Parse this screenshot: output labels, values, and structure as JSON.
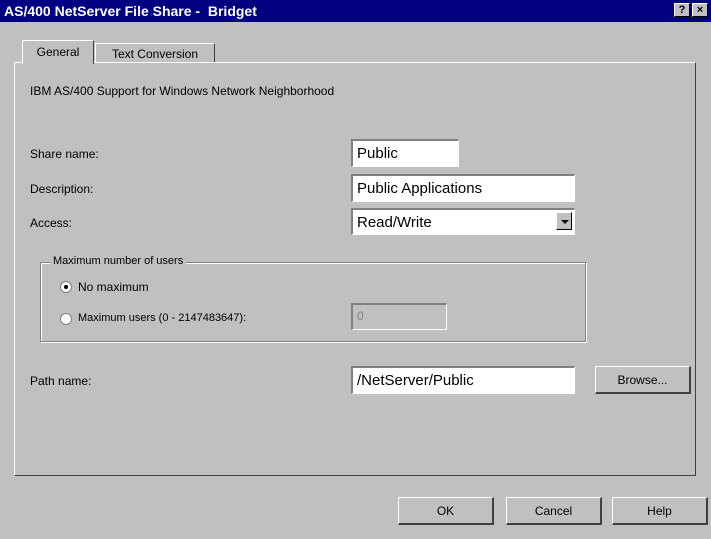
{
  "window": {
    "title": "AS/400 NetServer File Share -  Bridget",
    "help_label": "?",
    "close_label": "×"
  },
  "tabs": [
    {
      "label": "General",
      "active": true
    },
    {
      "label": "Text Conversion",
      "active": false
    }
  ],
  "general": {
    "description_text": "IBM AS/400 Support for Windows Network Neighborhood",
    "share_name_label": "Share name:",
    "share_name_value": "Public",
    "description_label": "Description:",
    "description_value": "Public Applications",
    "access_label": "Access:",
    "access_value": "Read/Write",
    "max_users_group": {
      "legend": "Maximum number of users",
      "no_maximum_label": "No maximum",
      "no_maximum_selected": true,
      "max_users_label": "Maximum users (0 - 2147483647):",
      "max_users_selected": false,
      "max_users_value": "0"
    },
    "path_name_label": "Path name:",
    "path_name_value": "/NetServer/Public",
    "browse_label": "Browse..."
  },
  "footer": {
    "ok_label": "OK",
    "cancel_label": "Cancel",
    "help_label": "Help"
  }
}
